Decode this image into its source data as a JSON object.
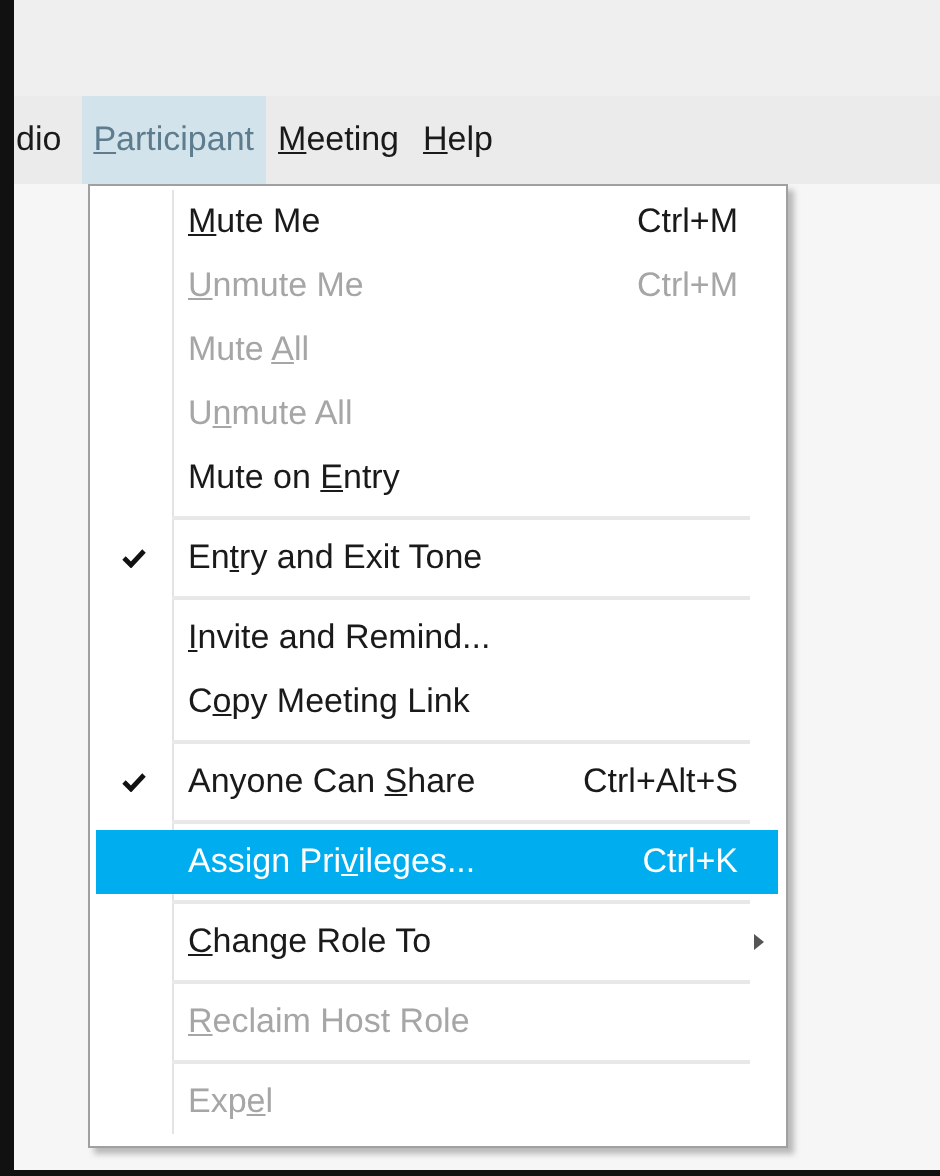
{
  "menu_bar": [
    {
      "before": "dio",
      "selected": false
    },
    {
      "key": "P",
      "after": "articipant",
      "selected": true
    },
    {
      "key": "M",
      "after": "eeting",
      "selected": false
    },
    {
      "key": "H",
      "after": "elp",
      "selected": false
    }
  ],
  "menu": [
    {
      "kind": "item",
      "key": "M",
      "after": "ute Me",
      "shortcut": "Ctrl+M",
      "disabled": false,
      "checked": false,
      "selected": false,
      "submenu": false
    },
    {
      "kind": "item",
      "key": "U",
      "after": "nmute Me",
      "shortcut": "Ctrl+M",
      "disabled": true,
      "checked": false,
      "selected": false,
      "submenu": false
    },
    {
      "kind": "item",
      "before": "Mute ",
      "key": "A",
      "after": "ll",
      "disabled": true,
      "checked": false,
      "selected": false,
      "submenu": false
    },
    {
      "kind": "item",
      "before": "U",
      "key": "n",
      "after": "mute All",
      "disabled": true,
      "checked": false,
      "selected": false,
      "submenu": false
    },
    {
      "kind": "item",
      "before": "Mute on ",
      "key": "E",
      "after": "ntry",
      "disabled": false,
      "checked": false,
      "selected": false,
      "submenu": false
    },
    {
      "kind": "separator"
    },
    {
      "kind": "item",
      "before": "En",
      "key": "t",
      "after": "ry and Exit Tone",
      "disabled": false,
      "checked": true,
      "selected": false,
      "submenu": false
    },
    {
      "kind": "separator"
    },
    {
      "kind": "item",
      "key": "I",
      "after": "nvite and Remind...",
      "disabled": false,
      "checked": false,
      "selected": false,
      "submenu": false
    },
    {
      "kind": "item",
      "before": "C",
      "key": "o",
      "after": "py Meeting Link",
      "disabled": false,
      "checked": false,
      "selected": false,
      "submenu": false
    },
    {
      "kind": "separator"
    },
    {
      "kind": "item",
      "before": "Anyone Can ",
      "key": "S",
      "after": "hare",
      "shortcut": "Ctrl+Alt+S",
      "disabled": false,
      "checked": true,
      "selected": false,
      "submenu": false
    },
    {
      "kind": "separator"
    },
    {
      "kind": "item",
      "before": "Assign Pri",
      "key": "v",
      "after": "ileges...",
      "shortcut": "Ctrl+K",
      "disabled": false,
      "checked": false,
      "selected": true,
      "submenu": false
    },
    {
      "kind": "separator"
    },
    {
      "kind": "item",
      "key": "C",
      "after": "hange Role To",
      "disabled": false,
      "checked": false,
      "selected": false,
      "submenu": true
    },
    {
      "kind": "separator"
    },
    {
      "kind": "item",
      "key": "R",
      "after": "eclaim Host Role",
      "disabled": true,
      "checked": false,
      "selected": false,
      "submenu": false
    },
    {
      "kind": "separator"
    },
    {
      "kind": "item",
      "before": "Exp",
      "key": "e",
      "after": "l",
      "disabled": true,
      "checked": false,
      "selected": false,
      "submenu": false
    }
  ]
}
